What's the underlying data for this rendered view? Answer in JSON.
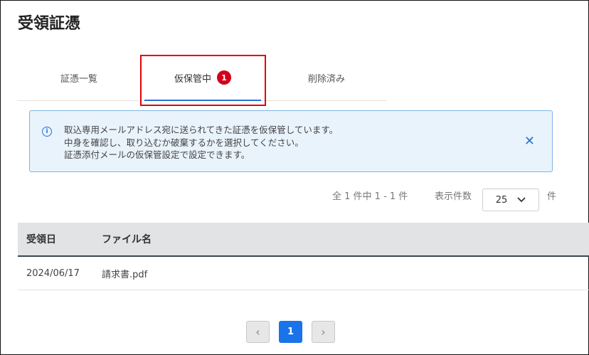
{
  "page": {
    "title": "受領証憑"
  },
  "tabs": [
    {
      "label": "証憑一覧"
    },
    {
      "label": "仮保管中",
      "badge": "1",
      "active": true
    },
    {
      "label": "削除済み"
    }
  ],
  "notice": {
    "icon": "info-icon",
    "lines": [
      "取込専用メールアドレス宛に送られてきた証憑を仮保管しています。",
      "中身を確認し、取り込むか破棄するかを選択してください。",
      "証憑添付メールの仮保管設定で設定できます。"
    ],
    "close_icon": "close-icon",
    "close_glyph": "✕"
  },
  "pager": {
    "count_text": "全 1 件中 1 - 1 件",
    "per_page_label": "表示件数",
    "per_page_value": "25",
    "per_page_unit": "件"
  },
  "table": {
    "columns": [
      "受領日",
      "ファイル名"
    ],
    "rows": [
      {
        "date": "2024/06/17",
        "file": "請求書.pdf"
      }
    ]
  },
  "pagination": {
    "prev_glyph": "‹",
    "current": "1",
    "next_glyph": "›"
  },
  "colors": {
    "accent": "#1a73e8",
    "badge": "#d0021b",
    "highlight": "#e60000",
    "notice_bg": "#e9f3fc"
  }
}
